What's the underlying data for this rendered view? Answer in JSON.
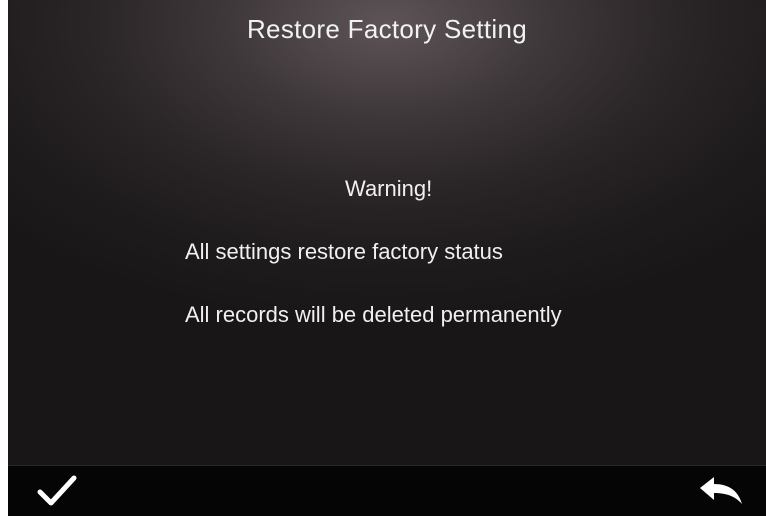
{
  "screen": {
    "title": "Restore Factory Setting",
    "warning": "Warning!",
    "messages": [
      "All settings restore factory status",
      "All records will be deleted permanently"
    ]
  },
  "bottom_bar": {
    "confirm_icon": "checkmark-icon",
    "back_icon": "return-arrow-icon"
  },
  "colors": {
    "text": "#f0f0f0",
    "bar": "#050505"
  }
}
